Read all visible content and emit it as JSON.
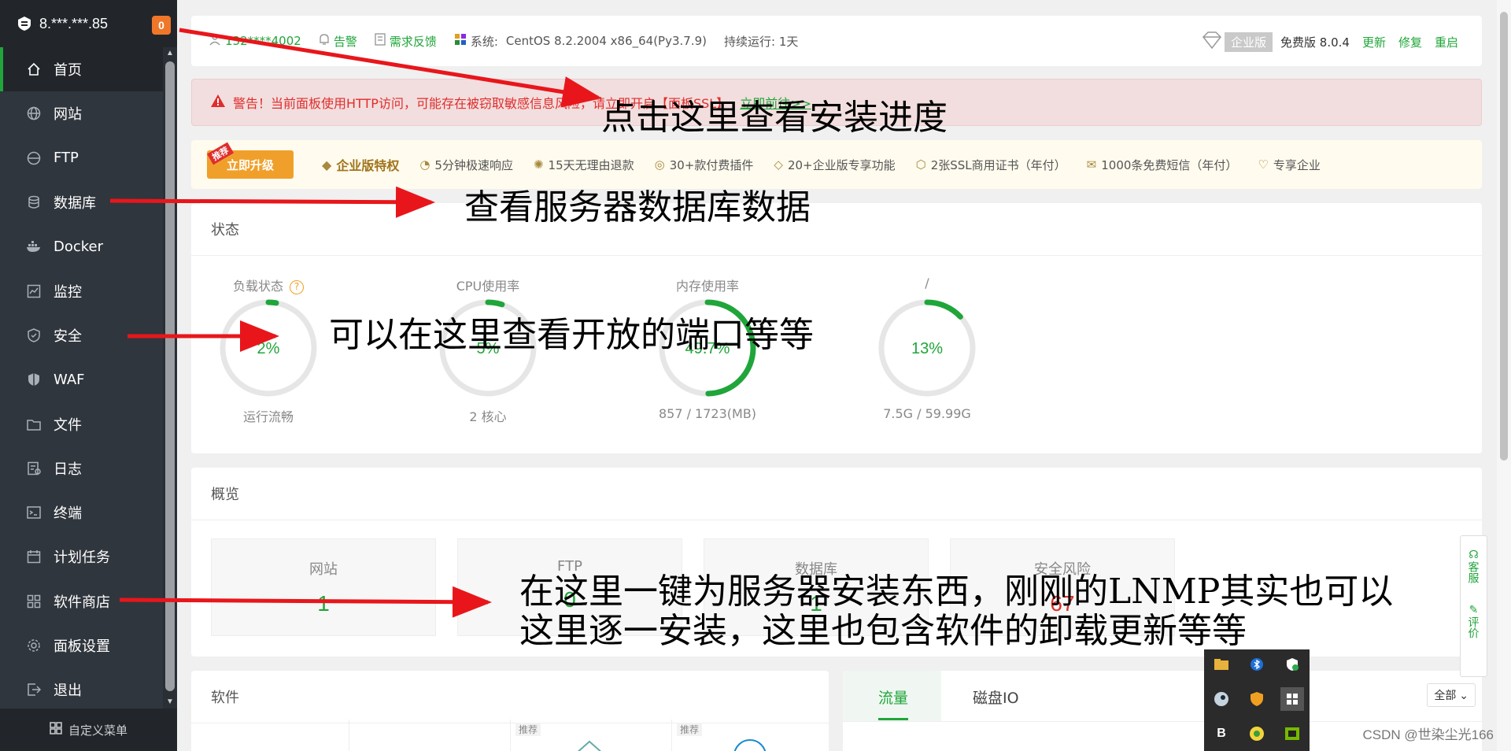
{
  "server": {
    "title": "8.***.***.85",
    "badge": "0"
  },
  "sidebar": {
    "items": [
      {
        "label": "首页",
        "icon": "home-icon",
        "active": true
      },
      {
        "label": "网站",
        "icon": "globe-icon"
      },
      {
        "label": "FTP",
        "icon": "ftp-icon"
      },
      {
        "label": "数据库",
        "icon": "database-icon"
      },
      {
        "label": "Docker",
        "icon": "docker-icon"
      },
      {
        "label": "监控",
        "icon": "monitor-icon"
      },
      {
        "label": "安全",
        "icon": "shield-icon"
      },
      {
        "label": "WAF",
        "icon": "waf-shield-icon"
      },
      {
        "label": "文件",
        "icon": "folder-icon"
      },
      {
        "label": "日志",
        "icon": "log-icon"
      },
      {
        "label": "终端",
        "icon": "terminal-icon"
      },
      {
        "label": "计划任务",
        "icon": "calendar-icon"
      },
      {
        "label": "软件商店",
        "icon": "grid-icon"
      },
      {
        "label": "面板设置",
        "icon": "gear-icon"
      },
      {
        "label": "退出",
        "icon": "logout-icon"
      }
    ],
    "footer": "自定义菜单"
  },
  "topbar": {
    "user": "132****4002",
    "alert": "告警",
    "feedback": "需求反馈",
    "system_label": "系统:",
    "system_value": "CentOS 8.2.2004 x86_64(Py3.7.9)",
    "uptime": "持续运行: 1天",
    "edition": "企业版",
    "version": "免费版 8.0.4",
    "update": "更新",
    "repair": "修复",
    "restart": "重启"
  },
  "warning": {
    "text": "警告！当前面板使用HTTP访问，可能存在被窃取敏感信息风险，请立即开启【面板SSL】",
    "link": "立即前往>>"
  },
  "promo": {
    "button": "立即升级",
    "tag": "推荐",
    "title": "企业版特权",
    "features": [
      "5分钟极速响应",
      "15天无理由退款",
      "30+款付费插件",
      "20+企业版专享功能",
      "2张SSL商用证书（年付）",
      "1000条免费短信（年付）",
      "专享企业"
    ]
  },
  "status": {
    "title": "状态",
    "gauges": [
      {
        "label": "负载状态",
        "value": "2%",
        "pct": 2,
        "sub": "运行流畅",
        "help": "?"
      },
      {
        "label": "CPU使用率",
        "value": "5%",
        "pct": 5,
        "sub": "2 核心"
      },
      {
        "label": "内存使用率",
        "value": "49.7%",
        "pct": 49.7,
        "sub": "857 / 1723(MB)"
      },
      {
        "label": "/",
        "value": "13%",
        "pct": 13,
        "sub": "7.5G / 59.99G"
      }
    ]
  },
  "overview": {
    "title": "概览",
    "boxes": [
      {
        "label": "网站",
        "value": "1",
        "color": "#20a53a"
      },
      {
        "label": "FTP",
        "value": "0",
        "color": "#20a53a"
      },
      {
        "label": "数据库",
        "value": "1",
        "color": "#20a53a"
      },
      {
        "label": "安全风险",
        "value": "67",
        "color": "#e02d2d"
      }
    ]
  },
  "software": {
    "title": "软件",
    "badges": [
      "推荐",
      "推荐"
    ]
  },
  "traffic": {
    "tab_flow": "流量",
    "tab_disk": "磁盘IO",
    "select": "全部"
  },
  "float": {
    "service": "客服",
    "review": "评价"
  },
  "annotations": {
    "a1": "点击这里查看安装进度",
    "a2": "查看服务器数据库数据",
    "a3": "可以在这里查看开放的端口等等",
    "a4_line1": "在这里一键为服务器安装东西，刚刚的LNMP其实也可以",
    "a4_line2": "这里逐一安装，这里也包含软件的卸载更新等等"
  },
  "watermark": "CSDN @世染尘光166",
  "colors": {
    "accent": "#20a53a",
    "sidebar": "#30363d",
    "warning": "#e02d2d",
    "arrow": "#e8161b"
  }
}
